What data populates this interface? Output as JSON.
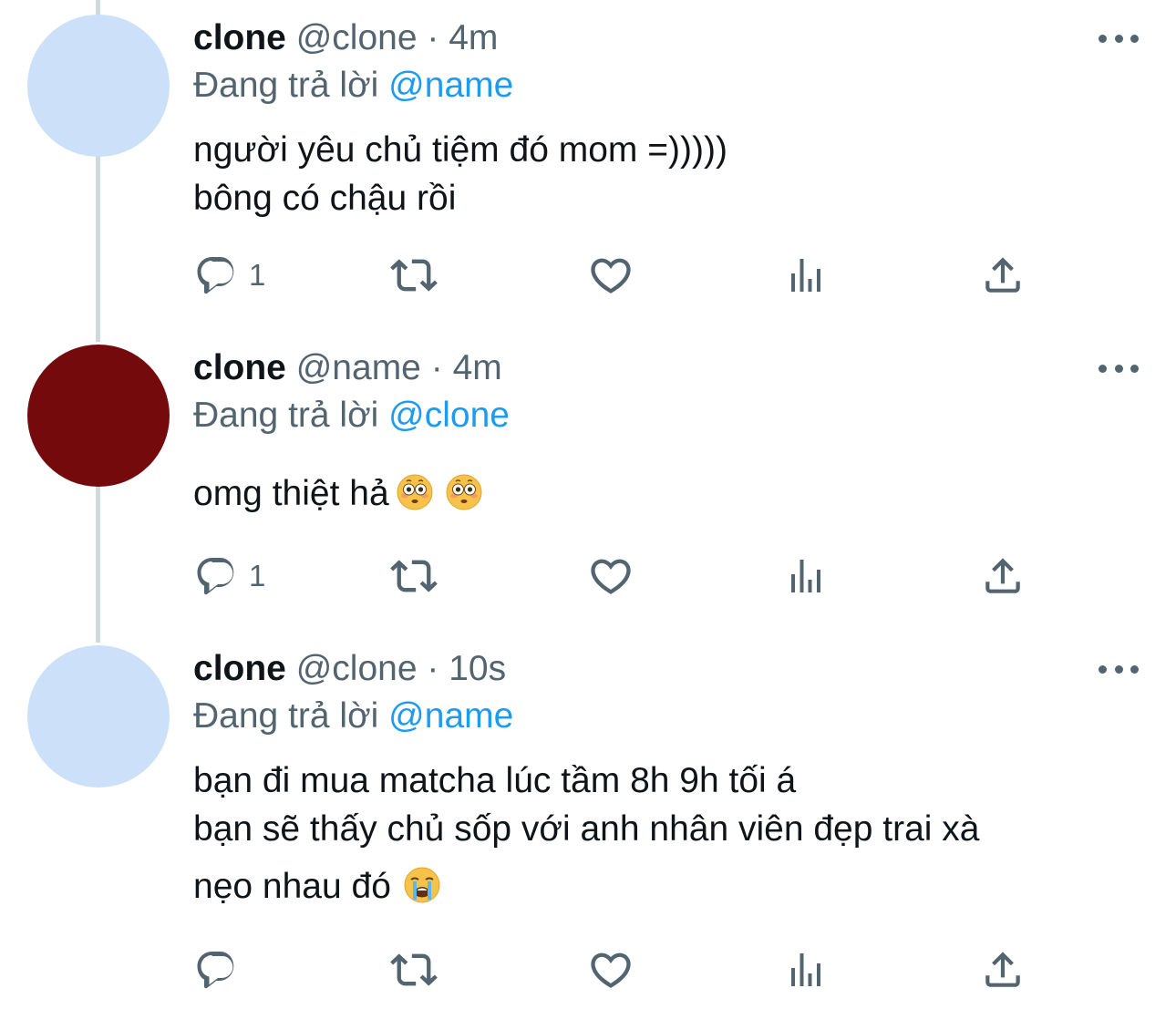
{
  "tweets": [
    {
      "display_name": "clone",
      "handle": "@clone",
      "separator": "·",
      "time": "4m",
      "replying_label": "Đang trả lời",
      "replying_to": "@name",
      "avatar_color": "#cce0fa",
      "lines": [
        "người yêu chủ tiệm đó mom =)))))",
        "bông có chậu rồi"
      ],
      "reply_count": "1"
    },
    {
      "display_name": "clone",
      "handle": "@name",
      "separator": "·",
      "time": "4m",
      "replying_label": "Đang trả lời",
      "replying_to": "@clone",
      "avatar_color": "#750a0d",
      "lines": [
        "omg thiệt hả"
      ],
      "emojis": [
        "flushed-face-emoji",
        "flushed-face-emoji"
      ],
      "reply_count": "1"
    },
    {
      "display_name": "clone",
      "handle": "@clone",
      "separator": "·",
      "time": "10s",
      "replying_label": "Đang trả lời",
      "replying_to": "@name",
      "avatar_color": "#cce0fa",
      "lines": [
        "bạn đi mua matcha lúc tầm 8h 9h tối á",
        "bạn sẽ thấy chủ sốp với anh nhân viên đẹp trai xà",
        "nẹo nhau đó"
      ],
      "emojis": [
        "loudly-crying-face-emoji"
      ],
      "reply_count": ""
    }
  ],
  "colors": {
    "text_primary": "#0f1419",
    "text_secondary": "#536471",
    "mention": "#1d9bf0",
    "thread_line": "#cfd9de"
  },
  "icons": [
    "reply-icon",
    "retweet-icon",
    "like-icon",
    "analytics-icon",
    "share-icon",
    "more-icon"
  ]
}
